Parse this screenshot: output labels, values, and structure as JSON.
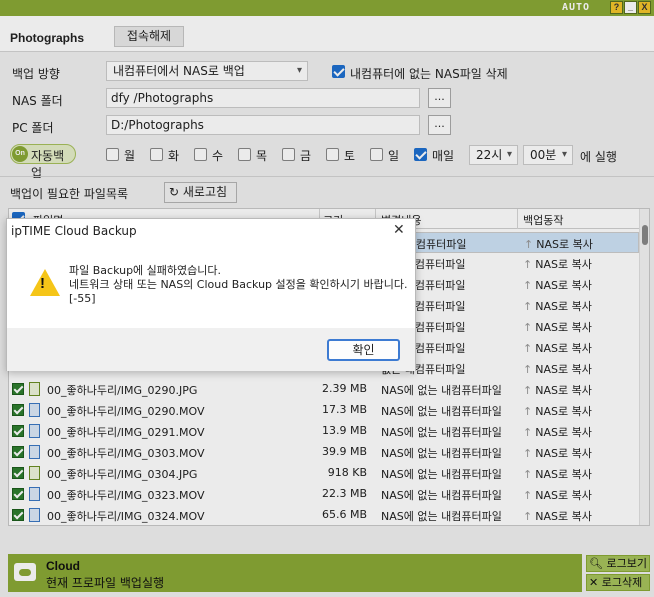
{
  "window": {
    "auto_label": "AUTO",
    "help": "?",
    "min": "_",
    "close": "X"
  },
  "header": {
    "title": "Photographs",
    "disconnect": "접속해제"
  },
  "settings": {
    "direction_label": "백업 방향",
    "direction_value": "내컴퓨터에서 NAS로 백업",
    "delete_check_label": "내컴퓨터에 없는 NAS파일 삭제",
    "nas_label": "NAS 폴더",
    "nas_value": "dfy /Photographs",
    "pc_label": "PC 폴더",
    "pc_value": "D:/Photographs",
    "browse": "...",
    "auto_toggle": "On",
    "auto_label": "자동백업",
    "days": [
      "월",
      "화",
      "수",
      "목",
      "금",
      "토",
      "일",
      "매일"
    ],
    "hour": "22시",
    "minute": "00분",
    "run_label": "에 실행"
  },
  "list": {
    "label": "백업이 필요한 파일목록",
    "refresh": "새로고침",
    "columns": [
      "파일명",
      "크기",
      "변경내용",
      "백업동작"
    ],
    "rows": [
      {
        "name": "00_좋하나두리/IMG_0290.JPG",
        "size": "2.39 MB",
        "change": "NAS에 없는 내컴퓨터파일",
        "action": "NAS로 복사",
        "type": "jpg"
      },
      {
        "name": "00_좋하나두리/IMG_0290.MOV",
        "size": "17.3 MB",
        "change": "NAS에 없는 내컴퓨터파일",
        "action": "NAS로 복사",
        "type": "mov"
      },
      {
        "name": "00_좋하나두리/IMG_0291.MOV",
        "size": "13.9 MB",
        "change": "NAS에 없는 내컴퓨터파일",
        "action": "NAS로 복사",
        "type": "mov"
      },
      {
        "name": "00_좋하나두리/IMG_0303.MOV",
        "size": "39.9 MB",
        "change": "NAS에 없는 내컴퓨터파일",
        "action": "NAS로 복사",
        "type": "mov"
      },
      {
        "name": "00_좋하나두리/IMG_0304.JPG",
        "size": "918 KB",
        "change": "NAS에 없는 내컴퓨터파일",
        "action": "NAS로 복사",
        "type": "jpg"
      },
      {
        "name": "00_좋하나두리/IMG_0323.MOV",
        "size": "22.3 MB",
        "change": "NAS에 없는 내컴퓨터파일",
        "action": "NAS로 복사",
        "type": "mov"
      },
      {
        "name": "00_좋하나두리/IMG_0324.MOV",
        "size": "65.6 MB",
        "change": "NAS에 없는 내컴퓨터파일",
        "action": "NAS로 복사",
        "type": "mov"
      }
    ],
    "hidden_rows": [
      {
        "change": "없는 내컴퓨터파일",
        "action": "NAS로 복사"
      },
      {
        "change": "없는 내컴퓨터파일",
        "action": "NAS로 복사"
      },
      {
        "change": "없는 내컴퓨터파일",
        "action": "NAS로 복사"
      },
      {
        "change": "없는 내컴퓨터파일",
        "action": "NAS로 복사"
      },
      {
        "change": "없는 내컴퓨터파일",
        "action": "NAS로 복사"
      },
      {
        "change": "없는 내컴퓨터파일",
        "action": "NAS로 복사"
      },
      {
        "change": "없는 내컴퓨터파일",
        "action": "NAS로 복사"
      }
    ]
  },
  "footer": {
    "title": "Cloud",
    "subtitle": "현재 프로파일 백업실행",
    "log_view": "로그보기",
    "log_delete": "로그삭제"
  },
  "dialog": {
    "title": "ipTIME Cloud Backup",
    "close": "✕",
    "message_line1": "파일 Backup에 실패하였습니다.",
    "message_line2": "네트워크 상태 또는 NAS의 Cloud Backup 설정을 확인하시기 바랍니다.[-55]",
    "ok": "확인"
  }
}
